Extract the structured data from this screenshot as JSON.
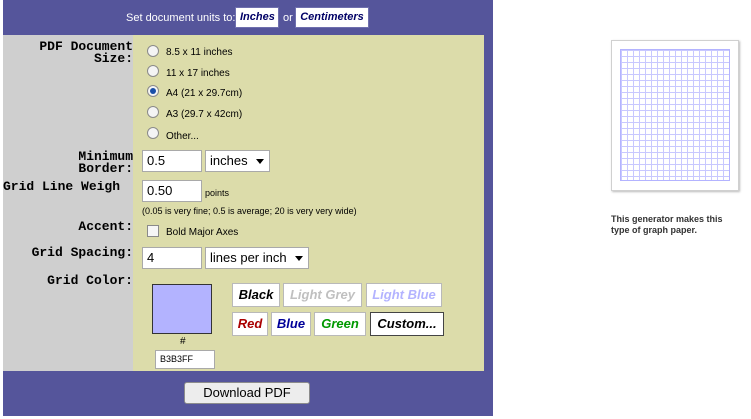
{
  "units_bar": {
    "prefix": "Set document units to:",
    "inches": "Inches",
    "or": "or",
    "centimeters": "Centimeters"
  },
  "labels": {
    "pdf_size": "PDF Document\nSize:",
    "min_border": "Minimum\nBorder:",
    "grid_line_weight": "Grid Line Weigh",
    "accent": "Accent:",
    "grid_spacing": "Grid Spacing:",
    "grid_color": "Grid Color:"
  },
  "size_options": [
    {
      "label": "8.5 x 11 inches",
      "selected": false
    },
    {
      "label": "11 x 17 inches",
      "selected": false
    },
    {
      "label": "A4 (21 x 29.7cm)",
      "selected": true
    },
    {
      "label": "A3 (29.7 x 42cm)",
      "selected": false
    },
    {
      "label": "Other...",
      "selected": false
    }
  ],
  "min_border": {
    "value": "0.5",
    "unit": "inches"
  },
  "line_weight": {
    "value": "0.50",
    "unit": "points",
    "hint": "(0.05 is very fine; 0.5 is average; 20 is very very wide)"
  },
  "accent": {
    "label": "Bold Major Axes",
    "checked": false
  },
  "spacing": {
    "value": "4",
    "unit": "lines per inch"
  },
  "color": {
    "hash": "#",
    "hex": "B3B3FF",
    "swatch": "#b3b3ff",
    "buttons": [
      {
        "label": "Black",
        "color": "#000000"
      },
      {
        "label": "Light Grey",
        "color": "#c0c0c0"
      },
      {
        "label": "Light Blue",
        "color": "#b3b3ff"
      },
      {
        "label": "Red",
        "color": "#aa0000"
      },
      {
        "label": "Blue",
        "color": "#000099"
      },
      {
        "label": "Green",
        "color": "#009900"
      },
      {
        "label": "Custom...",
        "color": "#000000"
      }
    ]
  },
  "download": {
    "label": "Download PDF"
  },
  "preview": {
    "caption": "This generator makes this type of graph paper."
  }
}
